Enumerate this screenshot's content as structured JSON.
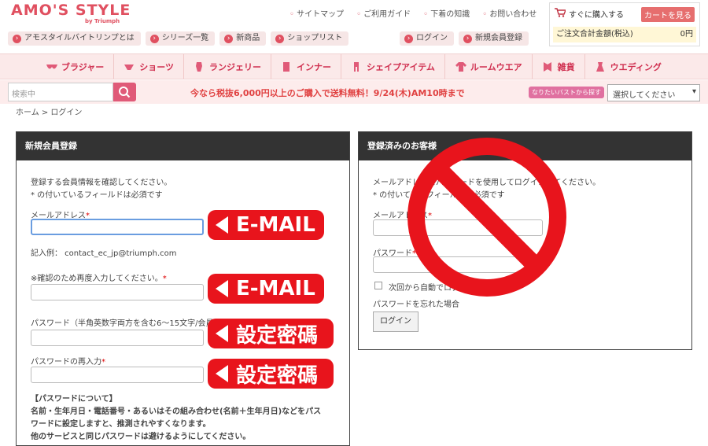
{
  "header": {
    "logo": "AMO'S STYLE",
    "logo_sub": "by Triumph",
    "top_links": [
      "サイトマップ",
      "ご利用ガイド",
      "下着の知識",
      "お問い合わせ"
    ],
    "sub_nav": [
      "アモスタイルバイトリンプとは",
      "シリーズ一覧",
      "新商品",
      "ショップリスト"
    ],
    "sub_nav_right": [
      "ログイン",
      "新規会員登録"
    ],
    "cart": {
      "buy_now": "すぐに購入する",
      "view_cart": "カートを見る",
      "total_label": "ご注文合計金額(税込)",
      "total_value": "0円"
    }
  },
  "categories": [
    "ブラジャー",
    "ショーツ",
    "ランジェリー",
    "インナー",
    "シェイプアイテム",
    "ルームウエア",
    "雑貨",
    "ウエディング"
  ],
  "search": {
    "placeholder": "検索中",
    "promo": "今なら税抜6,000円以上のご購入で送料無料！9/24(木)AM10時まで",
    "bust_button": "なりたいバストから探す",
    "bust_select": "選択してください"
  },
  "breadcrumb": "ホーム > ログイン",
  "register": {
    "title": "新規会員登録",
    "intro": "登録する会員情報を確認してください。",
    "required_note": "* の付いているフィールドは必須です",
    "email_label": "メールアドレス",
    "email_example": "記入例： contact_ec_jp@triumph.com",
    "email_confirm_label": "※確認のため再度入力してください。",
    "password_label": "パスワード（半角英数字両方を含む6～15文字/会員ID不可）",
    "password_confirm_label": "パスワードの再入力",
    "password_note_title": "【パスワードについて】",
    "password_note_1": "名前・生年月日・電話番号・あるいはその組み合わせ(名前＋生年月日)などをパス",
    "password_note_2": "ワードに設定しますと、推測されやすくなります。",
    "password_note_3": "他のサービスと同じパスワードは避けるようにしてください。",
    "asterisk": "*"
  },
  "login": {
    "title": "登録済みのお客様",
    "intro": "メールアドレスとパスワードを使用してログインしてください。",
    "required_note": "* の付いているフィールドは必須です",
    "email_label": "メールアドレス",
    "password_label": "パスワード",
    "remember": "次回から自動でログインする",
    "forgot": "パスワードを忘れた場合",
    "login_button": "ログイン"
  },
  "callouts": {
    "email_1": "E-MAIL",
    "email_2": "E-MAIL",
    "password_1": "設定密碼",
    "password_2": "設定密碼"
  },
  "colors": {
    "brand": "#e05060",
    "callout": "#e8141c",
    "panel_head": "#333333",
    "no_sign": "#e8141c"
  }
}
